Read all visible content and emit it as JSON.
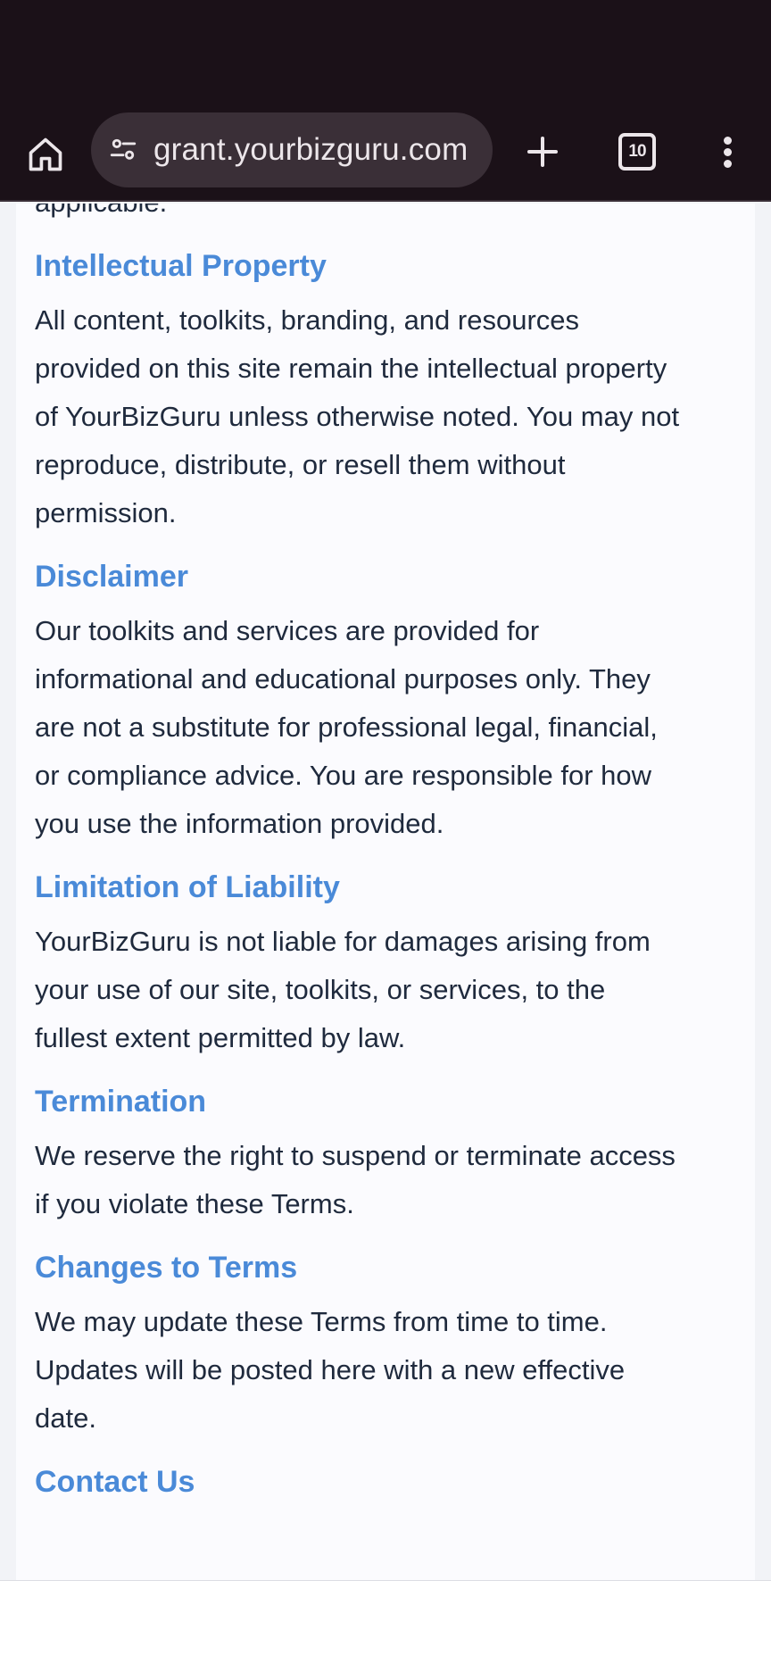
{
  "browser": {
    "url": "grant.yourbizguru.com",
    "tab_count": "10"
  },
  "page": {
    "intro_tail": "applicable.",
    "sections": [
      {
        "heading": "Intellectual Property",
        "body_lines": [
          "All content, toolkits, branding, and resources",
          "provided on this site remain the intellectual property",
          "of YourBizGuru unless otherwise noted. You may not",
          "reproduce, distribute, or resell them without",
          "permission."
        ]
      },
      {
        "heading": "Disclaimer",
        "body_lines": [
          "Our toolkits and services are provided for",
          "informational and educational purposes only. They",
          "are not a substitute for professional legal, financial,",
          "or compliance advice. You are responsible for how",
          "you use the information provided."
        ]
      },
      {
        "heading": "Limitation of Liability",
        "body_lines": [
          "YourBizGuru is not liable for damages arising from",
          "your use of our site, toolkits, or services, to the",
          "fullest extent permitted by law."
        ]
      },
      {
        "heading": "Termination",
        "body_lines": [
          "We reserve the right to suspend or terminate access",
          "if you violate these Terms."
        ]
      },
      {
        "heading": "Changes to Terms",
        "body_lines": [
          "We may update these Terms from time to time.",
          "Updates will be posted here with a new effective",
          "date."
        ]
      },
      {
        "heading": "Contact Us",
        "body_lines": []
      }
    ]
  },
  "colors": {
    "heading": "#4a8ad8",
    "body_text": "#1f2a3d",
    "browser_chrome": "#1b1118"
  }
}
